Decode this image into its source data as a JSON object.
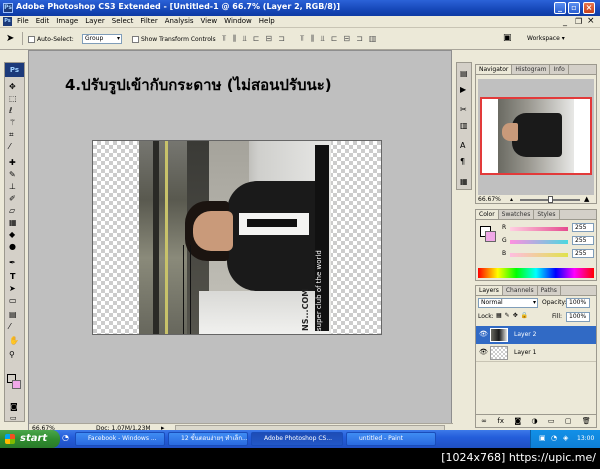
{
  "window": {
    "title": "Adobe Photoshop CS3 Extended - [Untitled-1 @ 66.7% (Layer 2, RGB/8)]",
    "app_icon_text": "Ps"
  },
  "menu": {
    "items": [
      "File",
      "Edit",
      "Image",
      "Layer",
      "Select",
      "Filter",
      "Analysis",
      "View",
      "Window",
      "Help"
    ]
  },
  "options": {
    "auto_select_label": "Auto-Select:",
    "auto_select_value": "Group",
    "show_transform_label": "Show Transform Controls",
    "workspace_label": "Workspace"
  },
  "document": {
    "instruction_text": "4.ปรับรูปเข้ากับกระดาษ (ไม่สอนปรับนะ)",
    "photo_text_1": "super club of the world",
    "photo_text_2": "NS...COM",
    "zoom": "66.67%",
    "doc_info": "Doc: 1.07M/1.23M"
  },
  "navigator": {
    "tabs": [
      "Navigator",
      "Histogram",
      "Info"
    ],
    "zoom": "66.67%"
  },
  "color": {
    "tabs": [
      "Color",
      "Swatches",
      "Styles"
    ],
    "channels": [
      {
        "label": "R",
        "value": "255",
        "color": "#e54b8f"
      },
      {
        "label": "G",
        "value": "255",
        "color": "#4bd8e0"
      },
      {
        "label": "B",
        "value": "255",
        "color": "#e0e24b"
      }
    ],
    "foreground": "#ffffff",
    "background": "#f0a8e8"
  },
  "layers": {
    "tabs": [
      "Layers",
      "Channels",
      "Paths"
    ],
    "blend_mode": "Normal",
    "opacity_label": "Opacity:",
    "opacity_value": "100%",
    "lock_label": "Lock:",
    "fill_label": "Fill:",
    "fill_value": "100%",
    "items": [
      {
        "name": "Layer 2",
        "selected": true
      },
      {
        "name": "Layer 1",
        "selected": false
      }
    ]
  },
  "taskbar": {
    "start_label": "start",
    "tasks": [
      {
        "label": "Facebook - Windows ...",
        "active": false
      },
      {
        "label": "12 ขั้นตอนง่ายๆ ทำเล็ก...",
        "active": false
      },
      {
        "label": "Adobe Photoshop CS...",
        "active": true
      },
      {
        "label": "untitled - Paint",
        "active": false
      }
    ],
    "clock": "13:00"
  },
  "watermark": "[1024x768] https://upic.me/"
}
